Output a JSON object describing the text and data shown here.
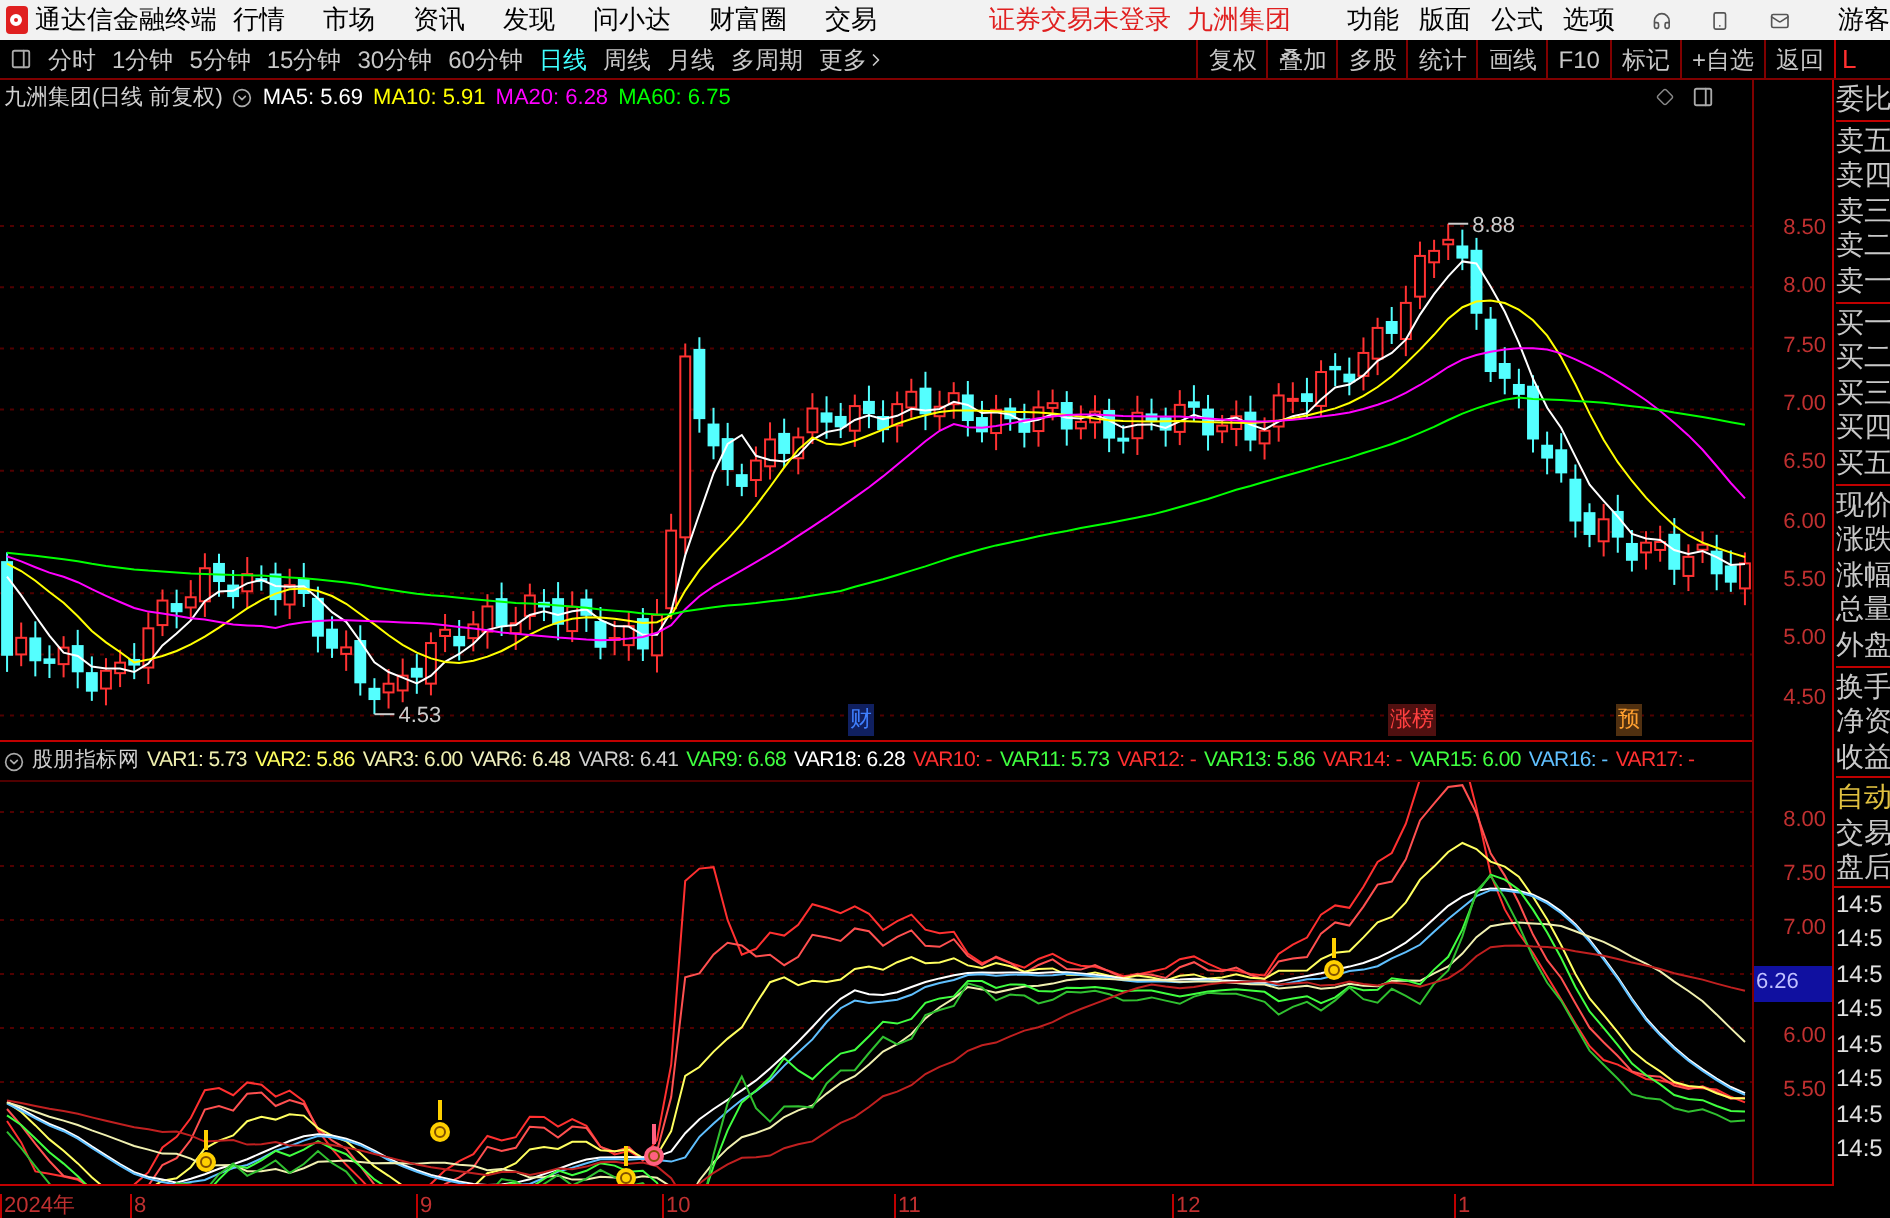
{
  "app": {
    "title": "通达信金融终端"
  },
  "menu": [
    "行情",
    "市场",
    "资讯",
    "发现",
    "问小达",
    "财富圈",
    "交易"
  ],
  "notice": "证券交易未登录",
  "stock_name": "九洲集团",
  "right_menu": [
    "功能",
    "版面",
    "公式",
    "选项"
  ],
  "user": "游客",
  "periods": [
    {
      "label": "分时",
      "selected": false
    },
    {
      "label": "1分钟",
      "selected": false
    },
    {
      "label": "5分钟",
      "selected": false
    },
    {
      "label": "15分钟",
      "selected": false
    },
    {
      "label": "30分钟",
      "selected": false
    },
    {
      "label": "60分钟",
      "selected": false
    },
    {
      "label": "日线",
      "selected": true
    },
    {
      "label": "周线",
      "selected": false
    },
    {
      "label": "月线",
      "selected": false
    },
    {
      "label": "多周期",
      "selected": false
    },
    {
      "label": "更多",
      "selected": false
    }
  ],
  "tools": [
    "复权",
    "叠加",
    "多股",
    "统计",
    "画线",
    "F10",
    "标记",
    "+自选",
    "返回"
  ],
  "side_flag": "L",
  "price_chart": {
    "title": "九洲集团(日线 前复权)",
    "averages": [
      {
        "label": "MA5: 5.69",
        "color": "#ffffff"
      },
      {
        "label": "MA10: 5.91",
        "color": "#ffff00"
      },
      {
        "label": "MA20: 6.28",
        "color": "#ff00ff"
      },
      {
        "label": "MA60: 6.75",
        "color": "#00ff00"
      }
    ],
    "axis": [
      "8.50",
      "8.00",
      "7.50",
      "7.00",
      "6.50",
      "6.00",
      "5.50",
      "5.00",
      "4.50"
    ],
    "high": "8.88",
    "low": "4.53",
    "events": [
      {
        "label": "财",
        "kind": "finance"
      },
      {
        "label": "涨榜",
        "kind": "rank"
      },
      {
        "label": "预",
        "kind": "forecast"
      }
    ]
  },
  "indicator": {
    "title": "股朋指标网",
    "values": [
      {
        "label": "VAR1: 5.73",
        "color": "#f0f0b0"
      },
      {
        "label": "VAR2: 5.86",
        "color": "#ffff60"
      },
      {
        "label": "VAR3: 6.00",
        "color": "#f0f0b0"
      },
      {
        "label": "VAR6: 6.48",
        "color": "#f0f0c0"
      },
      {
        "label": "VAR8: 6.41",
        "color": "#d0d0d0"
      },
      {
        "label": "VAR9: 6.68",
        "color": "#40ff40"
      },
      {
        "label": "VAR18: 6.28",
        "color": "#ffffff"
      },
      {
        "label": "VAR10: -",
        "color": "#ff3030"
      },
      {
        "label": "VAR11: 5.73",
        "color": "#40ff40"
      },
      {
        "label": "VAR12: -",
        "color": "#ff3030"
      },
      {
        "label": "VAR13: 5.86",
        "color": "#40ff40"
      },
      {
        "label": "VAR14: -",
        "color": "#ff3030"
      },
      {
        "label": "VAR15: 6.00",
        "color": "#40ff40"
      },
      {
        "label": "VAR16: -",
        "color": "#60c0ff"
      },
      {
        "label": "VAR17: -",
        "color": "#ff3030"
      }
    ],
    "axis": [
      {
        "label": "8.00",
        "kind": "tick"
      },
      {
        "label": "7.50",
        "kind": "tick"
      },
      {
        "label": "7.00",
        "kind": "tick"
      },
      {
        "label": "6.26",
        "kind": "cursor"
      },
      {
        "label": "6.00",
        "kind": "tick"
      },
      {
        "label": "5.50",
        "kind": "tick"
      }
    ]
  },
  "quote_groups": [
    [
      "委比"
    ],
    [
      "卖五",
      "卖四",
      "卖三",
      "卖二",
      "卖一"
    ],
    [
      "买一",
      "买二",
      "买三",
      "买四",
      "买五"
    ],
    [
      "现价",
      "涨跌",
      "涨幅",
      "总量",
      "外盘"
    ],
    [
      "换手",
      "净资",
      "收益"
    ]
  ],
  "trade_panel": {
    "mode": "自动",
    "labels": [
      "交易",
      "盘后"
    ],
    "times": [
      "14:5",
      "14:5",
      "14:5",
      "14:5",
      "14:5",
      "14:5",
      "14:5",
      "14:5"
    ]
  },
  "time_axis": [
    "2024年",
    "8",
    "9",
    "10",
    "11",
    "12",
    "1"
  ]
}
